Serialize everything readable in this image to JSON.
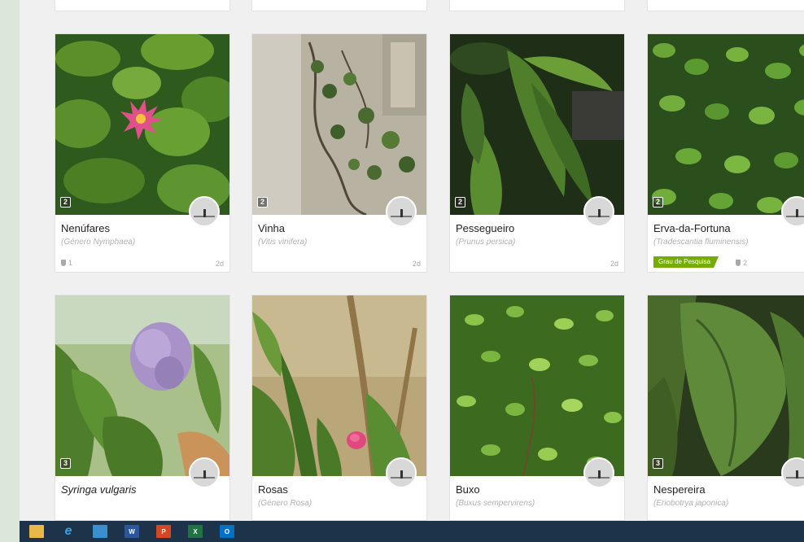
{
  "observations": [
    {
      "name": "Nenúfares",
      "scientific": "(Género Nymphaea)",
      "photo_count": "2",
      "ids": "1",
      "age": "2d"
    },
    {
      "name": "Vinha",
      "scientific": "(Vitis vinifera)",
      "photo_count": "2",
      "age": "2d"
    },
    {
      "name": "Pessegueiro",
      "scientific": "(Prunus persica)",
      "photo_count": "2",
      "age": "2d"
    },
    {
      "name": "Erva-da-Fortuna",
      "scientific": "(Tradescantia fluminensis)",
      "photo_count": "2",
      "grade": "Grau de Pesquisa",
      "ids": "2"
    },
    {
      "name": "Syringa vulgaris",
      "photo_count": "3"
    },
    {
      "name": "Rosas",
      "scientific": "(Género Rosa)"
    },
    {
      "name": "Buxo",
      "scientific": "(Buxus sempervirens)"
    },
    {
      "name": "Nespereira",
      "scientific": "(Eriobotrya japonica)",
      "photo_count": "3"
    }
  ],
  "taskbar": {
    "icons": [
      "file-explorer-icon",
      "internet-explorer-icon",
      "calculator-icon",
      "word-icon",
      "powerpoint-icon",
      "excel-icon",
      "outlook-icon"
    ],
    "labels": [
      "",
      "e",
      "",
      "W",
      "P",
      "X",
      "O"
    ]
  },
  "colors": {
    "grade": "#74ac00",
    "taskbar": "#1d3349"
  }
}
